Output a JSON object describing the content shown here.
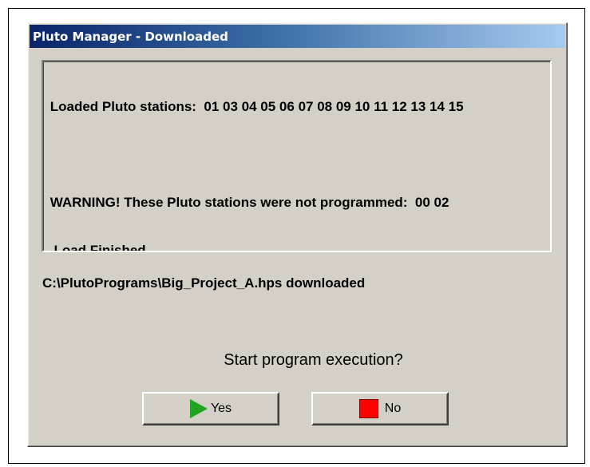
{
  "window": {
    "title": "Pluto Manager - Downloaded"
  },
  "log": {
    "lines": [
      " Loaded Pluto stations:  01 03 04 05 06 07 08 09 10 11 12 13 14 15",
      "",
      " WARNING! These Pluto stations were not programmed:  00 02",
      "  Load Finished"
    ]
  },
  "status": {
    "downloaded_path": "C:\\PlutoPrograms\\Big_Project_A.hps downloaded"
  },
  "prompt": {
    "question": "Start program execution?"
  },
  "buttons": {
    "yes_label": "Yes",
    "no_label": "No",
    "yes_icon": "play-icon",
    "no_icon": "stop-icon"
  },
  "colors": {
    "title_gradient_start": "#0a246a",
    "title_gradient_end": "#a6caf0",
    "dialog_face": "#d4d0c8",
    "play_green": "#1fa51f",
    "stop_red": "#ff0000"
  }
}
